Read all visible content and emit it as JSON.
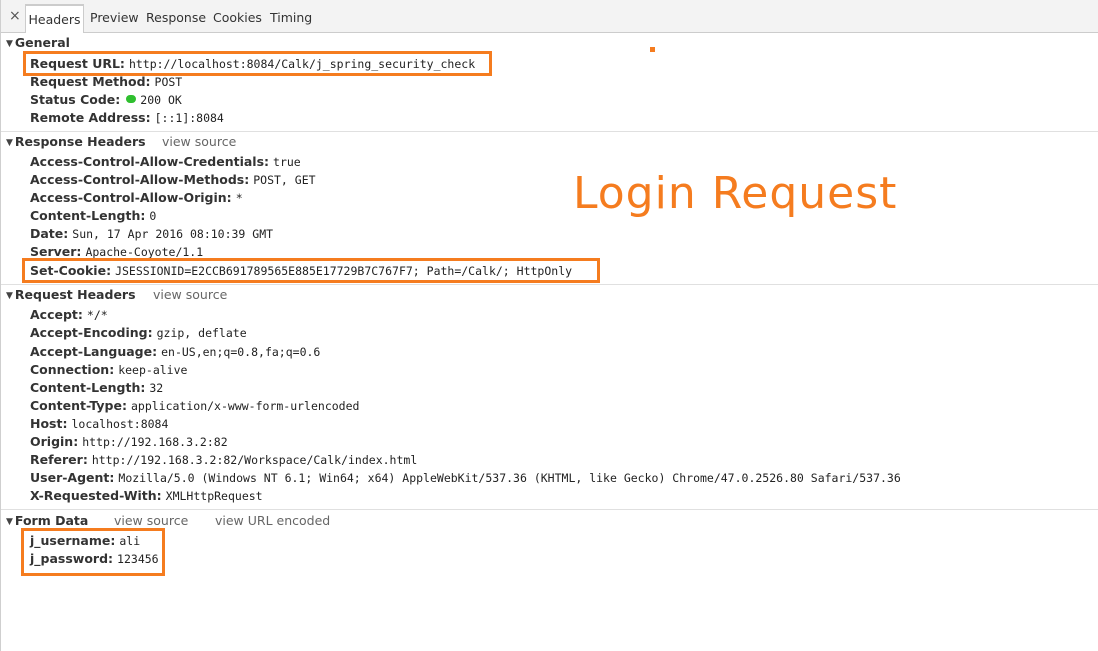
{
  "tabs": {
    "close": "×",
    "items": [
      {
        "label": "Headers"
      },
      {
        "label": "Preview"
      },
      {
        "label": "Response"
      },
      {
        "label": "Cookies"
      },
      {
        "label": "Timing"
      }
    ]
  },
  "general": {
    "title": "General",
    "request_url": {
      "key": "Request URL:",
      "value": "http://localhost:8084/Calk/j_spring_security_check"
    },
    "request_method": {
      "key": "Request Method:",
      "value": "POST"
    },
    "status_code": {
      "key": "Status Code:",
      "value": "200 OK",
      "status_color": "#2fbf2f"
    },
    "remote_address": {
      "key": "Remote Address:",
      "value": "[::1]:8084"
    }
  },
  "response_headers": {
    "title": "Response Headers",
    "view_source": "view source",
    "items": [
      {
        "key": "Access-Control-Allow-Credentials:",
        "value": "true"
      },
      {
        "key": "Access-Control-Allow-Methods:",
        "value": "POST, GET"
      },
      {
        "key": "Access-Control-Allow-Origin:",
        "value": "*"
      },
      {
        "key": "Content-Length:",
        "value": "0"
      },
      {
        "key": "Date:",
        "value": "Sun, 17 Apr 2016 08:10:39 GMT"
      },
      {
        "key": "Server:",
        "value": "Apache-Coyote/1.1"
      },
      {
        "key": "Set-Cookie:",
        "value": "JSESSIONID=E2CCB691789565E885E17729B7C767F7; Path=/Calk/; HttpOnly"
      }
    ]
  },
  "request_headers": {
    "title": "Request Headers",
    "view_source": "view source",
    "items": [
      {
        "key": "Accept:",
        "value": "*/*"
      },
      {
        "key": "Accept-Encoding:",
        "value": "gzip, deflate"
      },
      {
        "key": "Accept-Language:",
        "value": "en-US,en;q=0.8,fa;q=0.6"
      },
      {
        "key": "Connection:",
        "value": "keep-alive"
      },
      {
        "key": "Content-Length:",
        "value": "32"
      },
      {
        "key": "Content-Type:",
        "value": "application/x-www-form-urlencoded"
      },
      {
        "key": "Host:",
        "value": "localhost:8084"
      },
      {
        "key": "Origin:",
        "value": "http://192.168.3.2:82"
      },
      {
        "key": "Referer:",
        "value": "http://192.168.3.2:82/Workspace/Calk/index.html"
      },
      {
        "key": "User-Agent:",
        "value": "Mozilla/5.0 (Windows NT 6.1; Win64; x64) AppleWebKit/537.36 (KHTML, like Gecko) Chrome/47.0.2526.80 Safari/537.36"
      },
      {
        "key": "X-Requested-With:",
        "value": "XMLHttpRequest"
      }
    ]
  },
  "form_data": {
    "title": "Form Data",
    "view_source": "view source",
    "view_url_encoded": "view URL encoded",
    "items": [
      {
        "key": "j_username:",
        "value": "ali"
      },
      {
        "key": "j_password:",
        "value": "123456"
      }
    ]
  },
  "annotation": {
    "text": "Login Request",
    "color": "#f57c1f"
  }
}
